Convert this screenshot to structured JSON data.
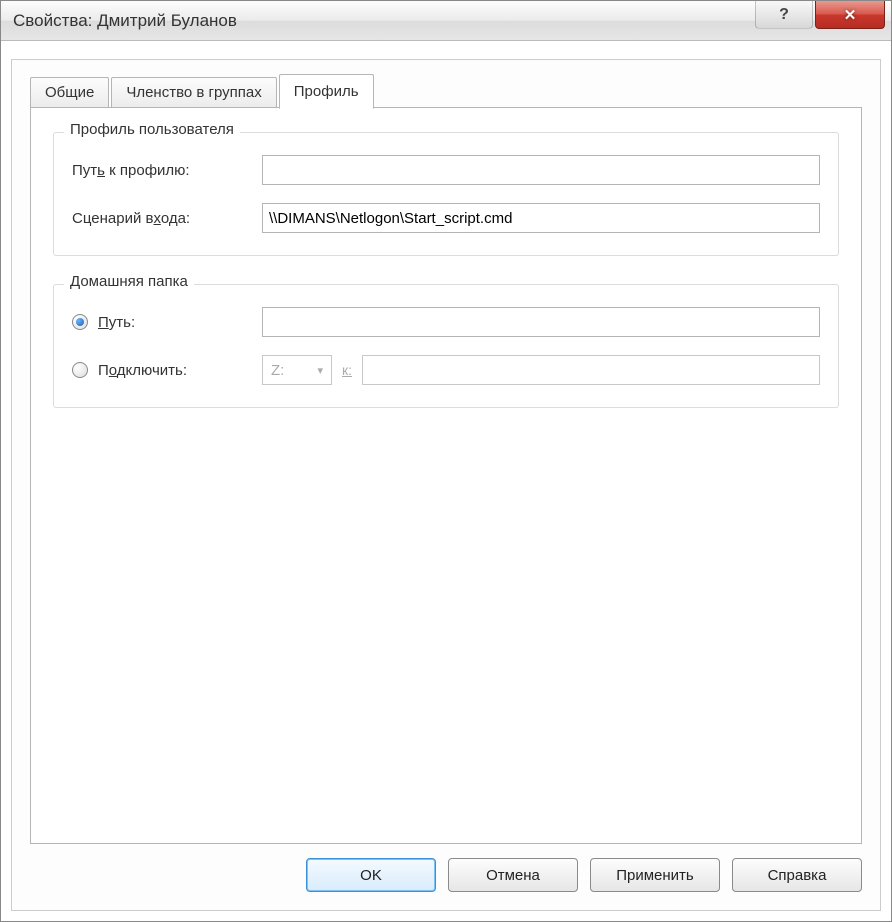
{
  "window": {
    "title": "Свойства: Дмитрий Буланов",
    "help_glyph": "?",
    "close_glyph": "✕"
  },
  "tabs": {
    "general": "Общие",
    "membership": "Членство в группах",
    "profile": "Профиль"
  },
  "user_profile_group": {
    "legend": "Профиль пользователя",
    "profile_path_label": "Путь к профилю:",
    "profile_path_value": "",
    "logon_script_label": "Сценарий входа:",
    "logon_script_value": "\\\\DIMANS\\Netlogon\\Start_script.cmd"
  },
  "home_folder_group": {
    "legend": "Домашняя папка",
    "local_path_label": "Путь:",
    "local_path_value": "",
    "connect_label": "Подключить:",
    "drive_value": "Z:",
    "to_label": "к:",
    "connect_path_value": ""
  },
  "buttons": {
    "ok": "OK",
    "cancel": "Отмена",
    "apply": "Применить",
    "help": "Справка"
  }
}
